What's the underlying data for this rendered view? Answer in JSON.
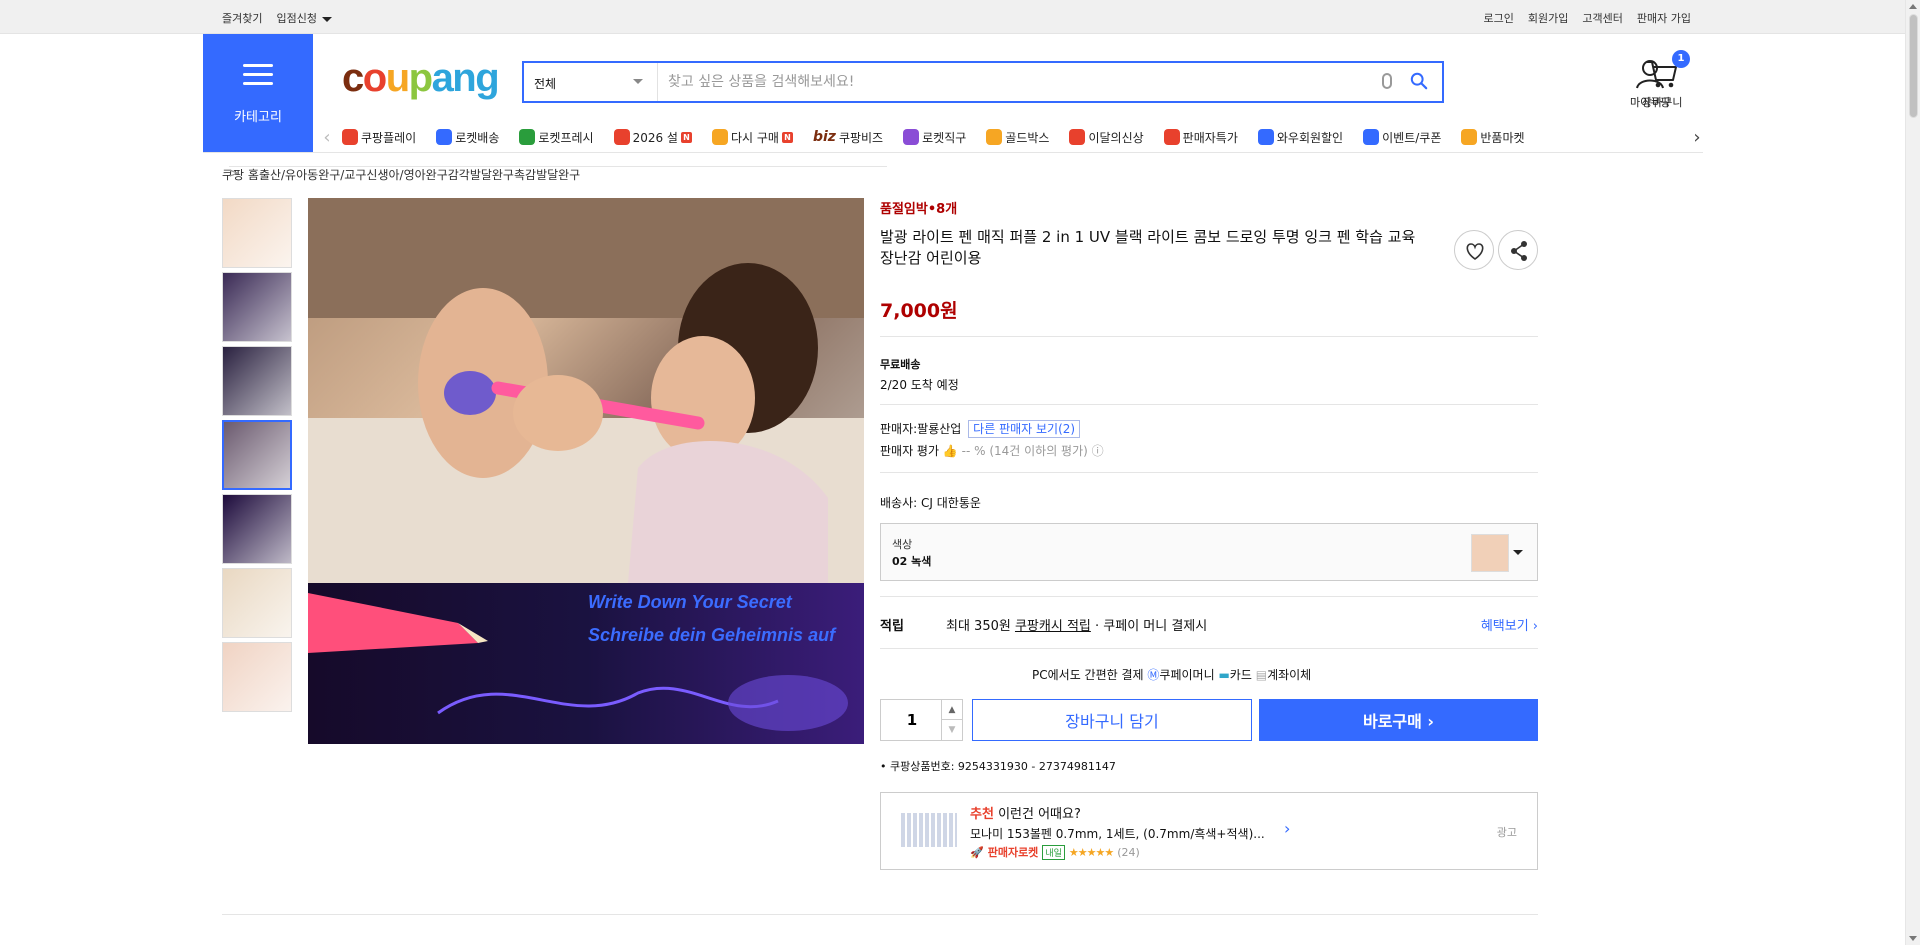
{
  "topbar": {
    "left": [
      "즐겨찾기",
      "입점신청"
    ],
    "right": [
      "로그인",
      "회원가입",
      "고객센터",
      "판매자 가입"
    ]
  },
  "header": {
    "category_label": "카테고리",
    "logo_parts": [
      "c",
      "o",
      "u",
      "p",
      "ang"
    ],
    "search_scope": "전체",
    "search_placeholder": "찾고 싶은 상품을 검색해보세요!",
    "mypage_label": "마이쿠팡",
    "cart_label": "장바구니",
    "cart_count": "1"
  },
  "menu": [
    {
      "label": "쿠팡플레이",
      "color": "#e8412d"
    },
    {
      "label": "로켓배송",
      "color": "#346aff"
    },
    {
      "label": "로켓프레시",
      "color": "#2a9d3c"
    },
    {
      "label": "2026 설",
      "color": "#e8412d",
      "new": "N"
    },
    {
      "label": "다시 구매",
      "color": "#f6a623",
      "new": "N"
    },
    {
      "label": "쿠팡비즈",
      "color": "#7b2d0f",
      "prefix": "biz"
    },
    {
      "label": "로켓직구",
      "color": "#8a4dd6"
    },
    {
      "label": "골드박스",
      "color": "#f6a623"
    },
    {
      "label": "이달의신상",
      "color": "#e8412d"
    },
    {
      "label": "판매자특가",
      "color": "#e8412d"
    },
    {
      "label": "와우회원할인",
      "color": "#346aff"
    },
    {
      "label": "이벤트/쿠폰",
      "color": "#346aff"
    },
    {
      "label": "반품마켓",
      "color": "#f6a623"
    }
  ],
  "breadcrumb": [
    "쿠팡 홈",
    "출산/유아동",
    "완구/교구",
    "신생아/영아완구",
    "감각발달완구",
    "촉감발달완구"
  ],
  "gallery": {
    "main_text_1": "Write Down Your Secret",
    "main_text_2": "Schreibe dein Geheimnis auf",
    "thumb_colors": [
      "#f2d9c5",
      "#3a2a55",
      "#2a2140",
      "#6b5a6f",
      "#1d0b3c",
      "#e9d8c2",
      "#f0d3c3"
    ],
    "selected_thumb": 3
  },
  "product": {
    "stock_notice": "품절임박•8개",
    "title": "발광 라이트 펜 매직 퍼플 2 in 1 UV 블랙 라이트 콤보 드로잉 투명 잉크 펜 학습 교육 장난감 어린이용",
    "price": "7,000원",
    "shipping_title": "무료배송",
    "arrival": "2/20 도착 예정",
    "seller_label": "판매자:",
    "seller_name": "팔룡산업",
    "other_sellers": "다른 판매자 보기(2)",
    "seller_rating_label": "판매자 평가",
    "seller_rating_value": "-- % (14건 이하의 평가)",
    "courier_label": "배송사:",
    "courier_name": "CJ 대한통운",
    "option_label": "색상",
    "option_value": "02 녹색",
    "reward_label": "적립",
    "reward_text": "최대 350원",
    "reward_link": "쿠팡캐시 적립",
    "reward_suffix": "· 쿠페이 머니 결제시",
    "benefit_link": "혜택보기",
    "pc_pay": "PC에서도 간편한 결제",
    "pay_methods": [
      "쿠페이머니",
      "카드",
      "계좌이체"
    ],
    "quantity": "1",
    "cart_button": "장바구니 담기",
    "buy_button": "바로구매",
    "product_number": "쿠팡상품번호: 9254331930 - 27374981147"
  },
  "recommend": {
    "prefix": "추천",
    "headline": "이런건 어때요?",
    "item": "모나미 153볼펜 0.7mm, 1세트, (0.7mm/흑색+적색)...",
    "badge": "판매자로켓",
    "badge2": "내일",
    "stars": "★★★★★",
    "reviews": "(24)",
    "ad": "광고"
  },
  "colors": {
    "accent": "#346aff",
    "price": "#ae0000"
  }
}
